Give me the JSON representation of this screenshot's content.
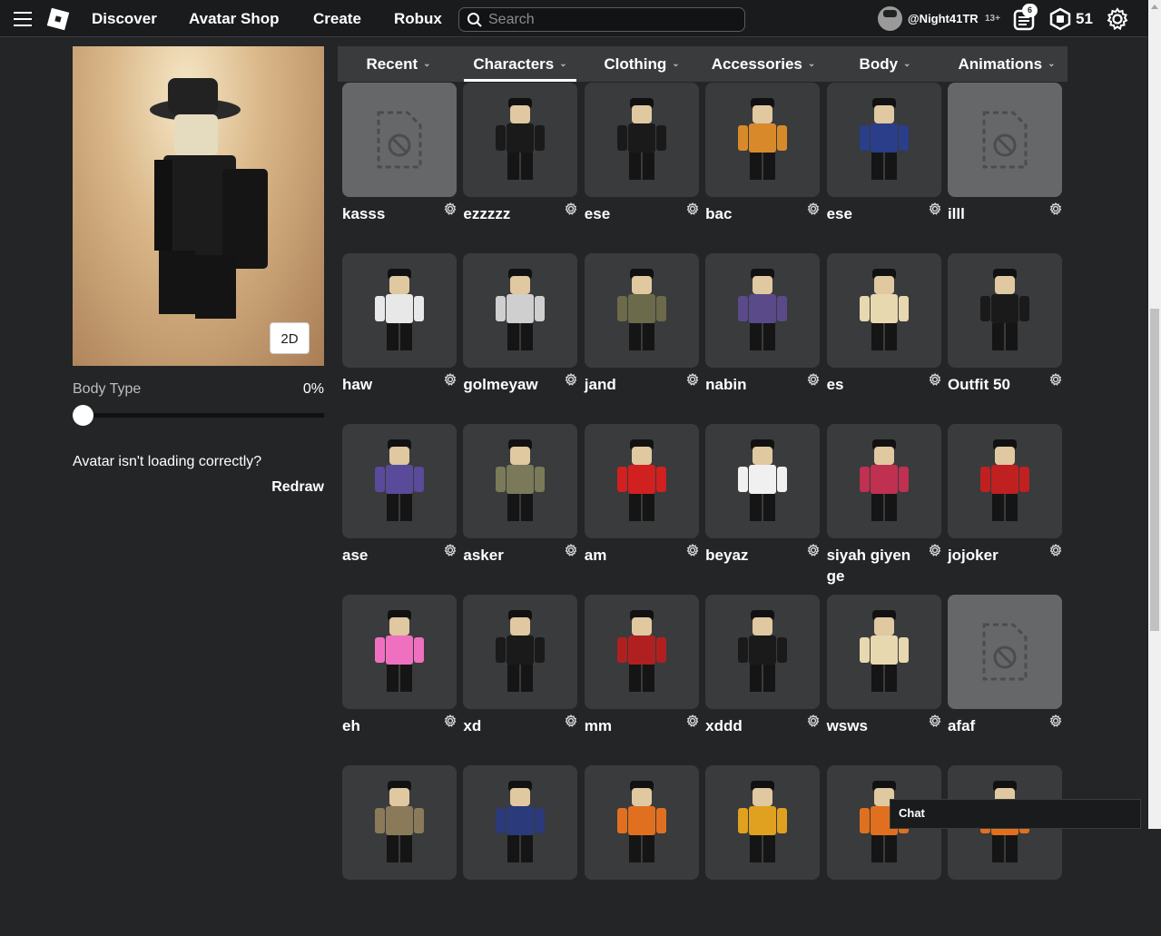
{
  "nav": {
    "discover": "Discover",
    "shop": "Avatar Shop",
    "create": "Create",
    "robux": "Robux",
    "search_placeholder": "Search"
  },
  "user": {
    "name": "@Night41TR",
    "age": "13+",
    "notifications": "6",
    "robux": "51"
  },
  "left": {
    "button_2d": "2D",
    "body_type_label": "Body Type",
    "body_type_value": "0%",
    "body_type_fraction": 0,
    "warning": "Avatar isn't loading correctly?",
    "redraw": "Redraw"
  },
  "tabs": [
    {
      "label": "Recent"
    },
    {
      "label": "Characters"
    },
    {
      "label": "Clothing"
    },
    {
      "label": "Accessories"
    },
    {
      "label": "Body"
    },
    {
      "label": "Animations"
    }
  ],
  "active_tab": "Characters",
  "characters": [
    {
      "name": "kasss",
      "empty": true
    },
    {
      "name": "ezzzzz"
    },
    {
      "name": "ese"
    },
    {
      "name": "bac",
      "color": "#d88a2a"
    },
    {
      "name": "ese",
      "color": "#2a3e8a"
    },
    {
      "name": "illl",
      "empty": true
    },
    {
      "name": "haw",
      "color": "#e8e8e8"
    },
    {
      "name": "golmeyaw",
      "color": "#cfcfcf"
    },
    {
      "name": "jand",
      "color": "#6b6a4a"
    },
    {
      "name": "nabin",
      "color": "#5a4a8a"
    },
    {
      "name": "es",
      "color": "#e8d8b0"
    },
    {
      "name": "Outfit 50"
    },
    {
      "name": "ase",
      "color": "#5a4a9a"
    },
    {
      "name": "asker",
      "color": "#7a7a5a"
    },
    {
      "name": "am",
      "color": "#d02020"
    },
    {
      "name": "beyaz",
      "color": "#f0f0f0"
    },
    {
      "name": "siyah giyen ge",
      "color": "#c03050"
    },
    {
      "name": "jojoker",
      "color": "#c02020"
    },
    {
      "name": "eh",
      "color": "#f070c0"
    },
    {
      "name": "xd"
    },
    {
      "name": "mm",
      "color": "#b02020"
    },
    {
      "name": "xddd"
    },
    {
      "name": "wsws",
      "color": "#e8d8b0"
    },
    {
      "name": "afaf",
      "empty": true
    },
    {
      "name": "",
      "color": "#8a7a5a"
    },
    {
      "name": "",
      "color": "#2a3a7a"
    },
    {
      "name": "",
      "color": "#e07020"
    },
    {
      "name": "",
      "color": "#e0a020"
    },
    {
      "name": "",
      "color": "#e07020"
    },
    {
      "name": "",
      "color": "#e07020"
    }
  ],
  "chat": {
    "label": "Chat"
  }
}
